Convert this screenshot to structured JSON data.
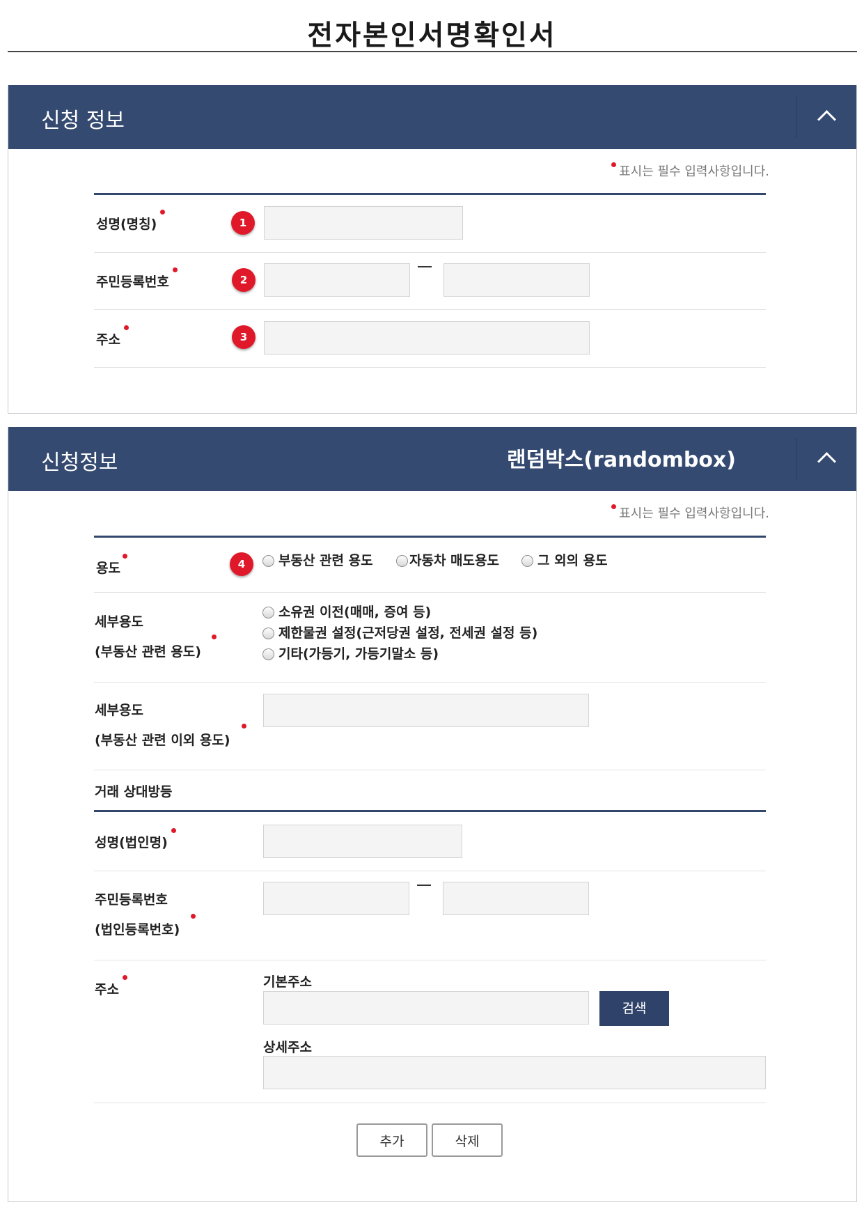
{
  "page": {
    "title": "전자본인서명확인서"
  },
  "section1": {
    "header_title": "신청 정보",
    "required_note": "표시는 필수 입력사항입니다.",
    "fields": {
      "name_label": "성명(명칭)",
      "rrn_label": "주민등록번호",
      "address_label": "주소"
    },
    "badges": [
      "1",
      "2",
      "3"
    ]
  },
  "section2": {
    "header_title": "신청정보",
    "header_extra": "랜덤박스(randombox)",
    "required_note": "표시는 필수 입력사항입니다.",
    "badge": "4",
    "purpose": {
      "label": "용도",
      "options": [
        "부동산 관련 용도",
        "자동차 매도용도",
        "그 외의 용도"
      ]
    },
    "detail_realestate": {
      "label_line1": "세부용도",
      "label_line2": "(부동산 관련 용도)",
      "options": [
        "소유권 이전(매매, 증여 등)",
        "제한물권 설정(근저당권 설정, 전세권 설정 등)",
        "기타(가등기, 가등기말소 등)"
      ]
    },
    "detail_other": {
      "label_line1": "세부용도",
      "label_line2": "(부동산 관련 이외 용도)"
    },
    "counterparty": {
      "heading": "거래 상대방등",
      "name_label": "성명(법인명)",
      "rrn_label_line1": "주민등록번호",
      "rrn_label_line2": "(법인등록번호)",
      "address_label": "주소",
      "basic_address_label": "기본주소",
      "detail_address_label": "상세주소",
      "search_button": "검색"
    },
    "buttons": {
      "add": "추가",
      "delete": "삭제"
    }
  },
  "colors": {
    "header_bg": "#344a71",
    "required": "#e0192a",
    "button_dark": "#2f4269"
  }
}
